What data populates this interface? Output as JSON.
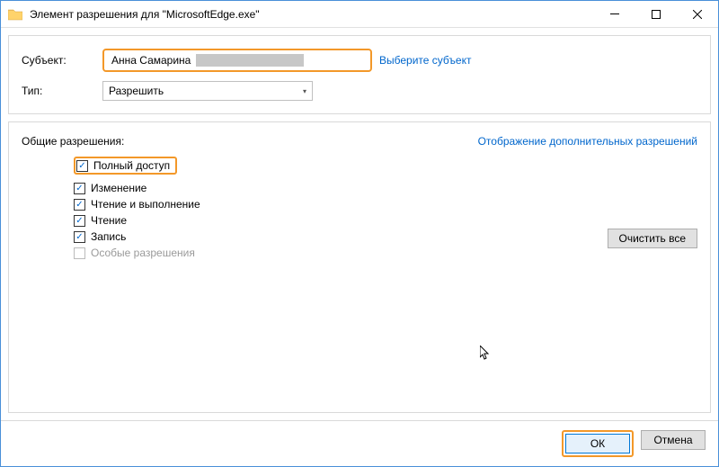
{
  "window": {
    "title": "Элемент разрешения для \"MicrosoftEdge.exe\""
  },
  "top": {
    "subject_label": "Субъект:",
    "subject_name": "Анна Самарина",
    "select_subject_link": "Выберите субъект",
    "type_label": "Тип:",
    "type_value": "Разрешить"
  },
  "main": {
    "basic_perms_label": "Общие разрешения:",
    "advanced_link": "Отображение дополнительных разрешений",
    "permissions": {
      "full_access": "Полный доступ",
      "modify": "Изменение",
      "read_execute": "Чтение и выполнение",
      "read": "Чтение",
      "write": "Запись",
      "special": "Особые разрешения"
    },
    "clear_all": "Очистить все"
  },
  "footer": {
    "ok": "ОК",
    "cancel": "Отмена"
  }
}
